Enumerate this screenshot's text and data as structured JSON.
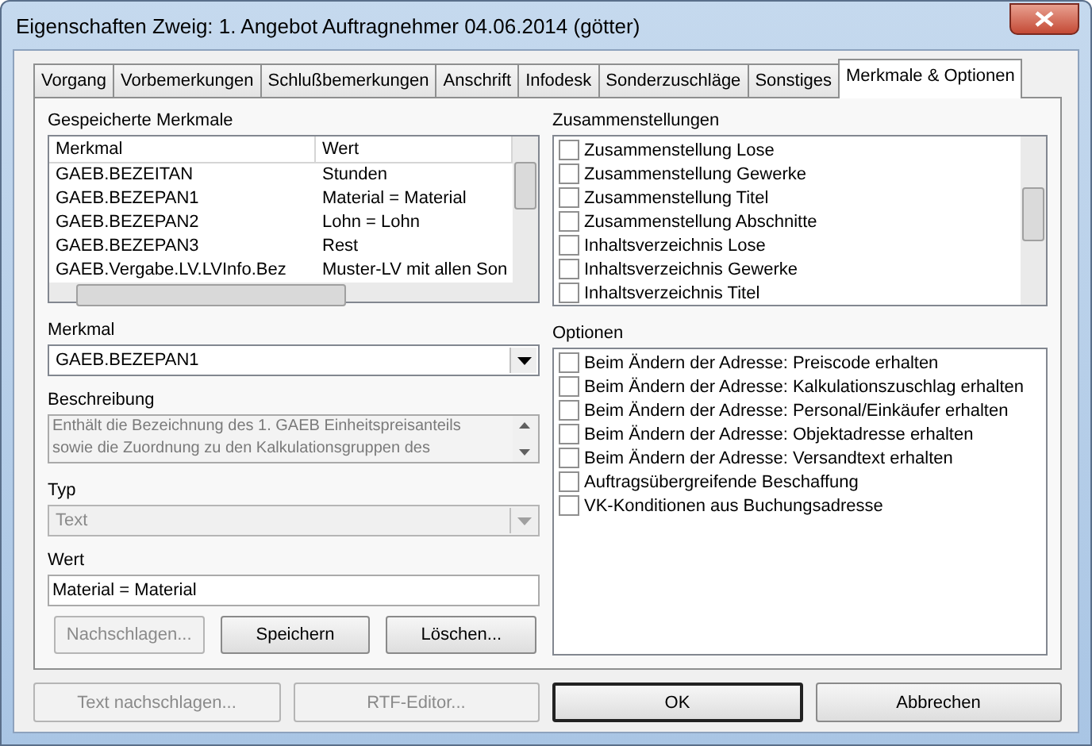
{
  "window": {
    "title": "Eigenschaften Zweig: 1. Angebot Auftragnehmer 04.06.2014 (götter)"
  },
  "tabs": [
    {
      "label": "Vorgang",
      "selected": false
    },
    {
      "label": "Vorbemerkungen",
      "selected": false
    },
    {
      "label": "Schlußbemerkungen",
      "selected": false
    },
    {
      "label": "Anschrift",
      "selected": false
    },
    {
      "label": "Infodesk",
      "selected": false
    },
    {
      "label": "Sonderzuschläge",
      "selected": false
    },
    {
      "label": "Sonstiges",
      "selected": false
    },
    {
      "label": "Merkmale & Optionen",
      "selected": true
    }
  ],
  "saved": {
    "label": "Gespeicherte Merkmale",
    "columns": [
      "Merkmal",
      "Wert"
    ],
    "rows": [
      [
        "GAEB.BEZEITAN",
        "Stunden"
      ],
      [
        "GAEB.BEZEPAN1",
        "Material = Material"
      ],
      [
        "GAEB.BEZEPAN2",
        "Lohn = Lohn"
      ],
      [
        "GAEB.BEZEPAN3",
        "Rest"
      ],
      [
        "GAEB.Vergabe.LV.LVInfo.Bez",
        "Muster-LV mit allen Son"
      ]
    ]
  },
  "merkmal": {
    "label": "Merkmal",
    "value": "GAEB.BEZEPAN1"
  },
  "beschreibung": {
    "label": "Beschreibung",
    "lines": [
      "Enthält die Bezeichnung des 1. GAEB Einheitspreisanteils",
      "sowie die Zuordnung zu den Kalkulationsgruppen des"
    ]
  },
  "typ": {
    "label": "Typ",
    "value": "Text",
    "disabled": true
  },
  "wert": {
    "label": "Wert",
    "value": "Material = Material"
  },
  "left_buttons": [
    {
      "label": "Nachschlagen...",
      "disabled": true
    },
    {
      "label": "Speichern",
      "disabled": false
    },
    {
      "label": "Löschen...",
      "disabled": false
    }
  ],
  "zusammenstellungen": {
    "label": "Zusammenstellungen",
    "items": [
      {
        "label": "Zusammenstellung Lose",
        "checked": false
      },
      {
        "label": "Zusammenstellung Gewerke",
        "checked": false
      },
      {
        "label": "Zusammenstellung Titel",
        "checked": false
      },
      {
        "label": "Zusammenstellung Abschnitte",
        "checked": false
      },
      {
        "label": "Inhaltsverzeichnis Lose",
        "checked": false
      },
      {
        "label": "Inhaltsverzeichnis Gewerke",
        "checked": false
      },
      {
        "label": "Inhaltsverzeichnis Titel",
        "checked": false
      }
    ]
  },
  "optionen": {
    "label": "Optionen",
    "items": [
      {
        "label": "Beim Ändern der Adresse: Preiscode erhalten",
        "checked": false
      },
      {
        "label": "Beim Ändern der Adresse: Kalkulationszuschlag erhalten",
        "checked": false
      },
      {
        "label": "Beim Ändern der Adresse: Personal/Einkäufer erhalten",
        "checked": false
      },
      {
        "label": "Beim Ändern der Adresse: Objektadresse erhalten",
        "checked": false
      },
      {
        "label": "Beim Ändern der Adresse: Versandtext erhalten",
        "checked": false
      },
      {
        "label": "Auftragsübergreifende Beschaffung",
        "checked": false
      },
      {
        "label": "VK-Konditionen aus Buchungsadresse",
        "checked": false
      }
    ]
  },
  "bottom_buttons": [
    {
      "label": "Text nachschlagen...",
      "disabled": true,
      "default": false
    },
    {
      "label": "RTF-Editor...",
      "disabled": true,
      "default": false
    },
    {
      "label": "OK",
      "disabled": false,
      "default": true
    },
    {
      "label": "Abbrechen",
      "disabled": false,
      "default": false
    }
  ]
}
